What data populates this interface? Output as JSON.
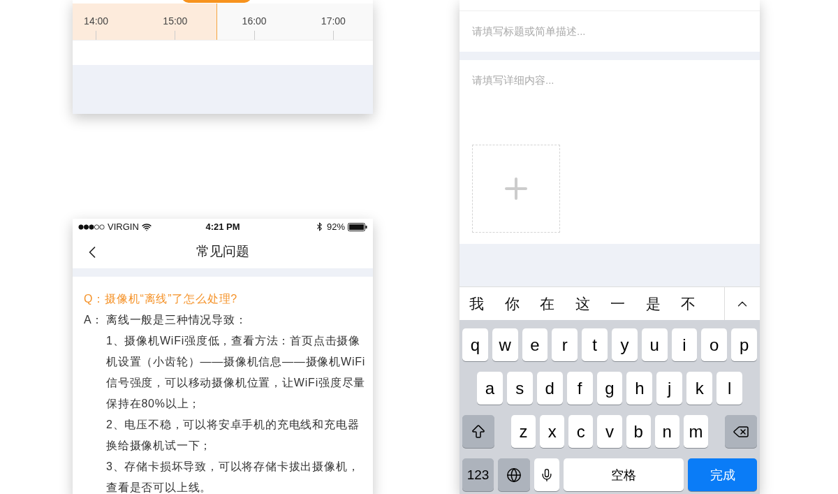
{
  "timeline_card": {
    "level": 0.479,
    "hour_labels": [
      "14:00",
      "15:00",
      "16:00",
      "17:00"
    ]
  },
  "faq_screen": {
    "status_bar": {
      "carrier": "VIRGIN",
      "time": "4:21 PM",
      "battery": "92%"
    },
    "title": "常见问题",
    "question": "Q：摄像机“离线”了怎么处理?",
    "answer_label": "A：",
    "answer_intro": "离线一般是三种情况导致：",
    "answer_items": [
      "1、摄像机WiFi强度低，查看方法：首页点击摄像机设置（小齿轮）——摄像机信息——摄像机WiFi信号强度，可以移动摄像机位置，让WiFi强度尽量保持在80%以上；",
      "2、电压不稳，可以将安卓手机的充电线和充电器换给摄像机试一下；",
      "3、存储卡损坏导致，可以将存储卡拔出摄像机，查看是否可以上线。"
    ]
  },
  "feedback_screen": {
    "title_field": {
      "placeholder": "请填写标题或简单描述..."
    },
    "detail_field": {
      "placeholder": "请填写详细内容..."
    },
    "candidates": [
      "我",
      "你",
      "在",
      "这",
      "一",
      "是",
      "不"
    ],
    "key_rows": [
      [
        "q",
        "w",
        "e",
        "r",
        "t",
        "y",
        "u",
        "i",
        "o",
        "p"
      ],
      [
        "a",
        "s",
        "d",
        "f",
        "g",
        "h",
        "j",
        "k",
        "l"
      ],
      [
        "z",
        "x",
        "c",
        "v",
        "b",
        "n",
        "m"
      ]
    ],
    "bottom_row": [
      {
        "kind": "number",
        "label": "123"
      },
      {
        "kind": "globe"
      },
      {
        "kind": "mic"
      },
      {
        "kind": "space",
        "label": "空格"
      },
      {
        "kind": "done",
        "label": "完成"
      }
    ]
  }
}
